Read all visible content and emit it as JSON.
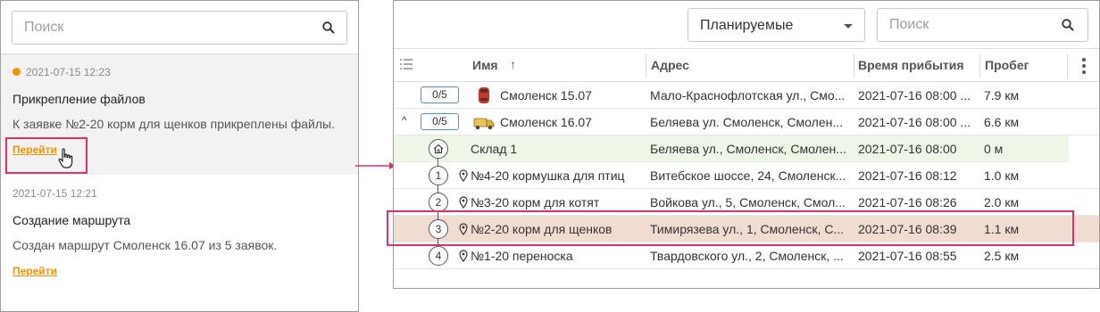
{
  "left_panel": {
    "search_placeholder": "Поиск",
    "notifications": [
      {
        "date": "2021-07-15 12:23",
        "unread": true,
        "title": "Прикрепление файлов",
        "text": "К заявке №2-20 корм для щенков прикреплены файлы.",
        "link": "Перейти"
      },
      {
        "date": "2021-07-15 12:21",
        "unread": false,
        "title": "Создание маршрута",
        "text": "Создан маршрут Смоленск 16.07 из 5 заявок.",
        "link": "Перейти"
      }
    ]
  },
  "right_panel": {
    "filter_value": "Планируемые",
    "search_placeholder": "Поиск",
    "columns": {
      "name": "Имя",
      "address": "Адрес",
      "arrival": "Время прибытия",
      "mileage": "Пробег"
    },
    "sort_indicator": "↑",
    "routes": [
      {
        "badge": "0/5",
        "vehicle_icon": "red-car-icon",
        "name": "Смоленск 15.07",
        "address": "Мало-Краснофлотская ул., Смо...",
        "arrival": "2021-07-16 08:00 ...",
        "mileage": "7.9 км",
        "expanded": false
      },
      {
        "badge": "0/5",
        "expander": "^",
        "vehicle_icon": "yellow-truck-icon",
        "name": "Смоленск 16.07",
        "address": "Беляева ул. Смоленск, Смолен...",
        "arrival": "2021-07-16 08:00 ...",
        "mileage": "6.6 км",
        "expanded": true
      }
    ],
    "stops": [
      {
        "marker": "home-icon",
        "name": "Склад 1",
        "address": "Беляева ул., Смоленск, Смолен...",
        "arrival": "2021-07-16 08:00",
        "mileage": "0 м"
      },
      {
        "marker": "1",
        "name": "№4-20 кормушка для птиц",
        "address": "Витебское шоссе, 24, Смоленск...",
        "arrival": "2021-07-16 08:12",
        "mileage": "1.0 км"
      },
      {
        "marker": "2",
        "name": "№3-20 корм для котят",
        "address": "Войкова ул., 5, Смоленск, Смол...",
        "arrival": "2021-07-16 08:26",
        "mileage": "2.0 км"
      },
      {
        "marker": "3",
        "name": "№2-20 корм для щенков",
        "address": "Тимирязева ул., 1, Смоленск, С...",
        "arrival": "2021-07-16 08:39",
        "mileage": "1.1 км"
      },
      {
        "marker": "4",
        "name": "№1-20 переноска",
        "address": "Твардовского ул., 2, Смоленск, ...",
        "arrival": "2021-07-16 08:55",
        "mileage": "2.5 км"
      }
    ]
  },
  "colors": {
    "accent": "#f39200",
    "highlight": "#e0306a",
    "selected_row": "#f1dcd2",
    "depot_row": "#eef6e8",
    "badge_border": "#5a8fbf"
  }
}
